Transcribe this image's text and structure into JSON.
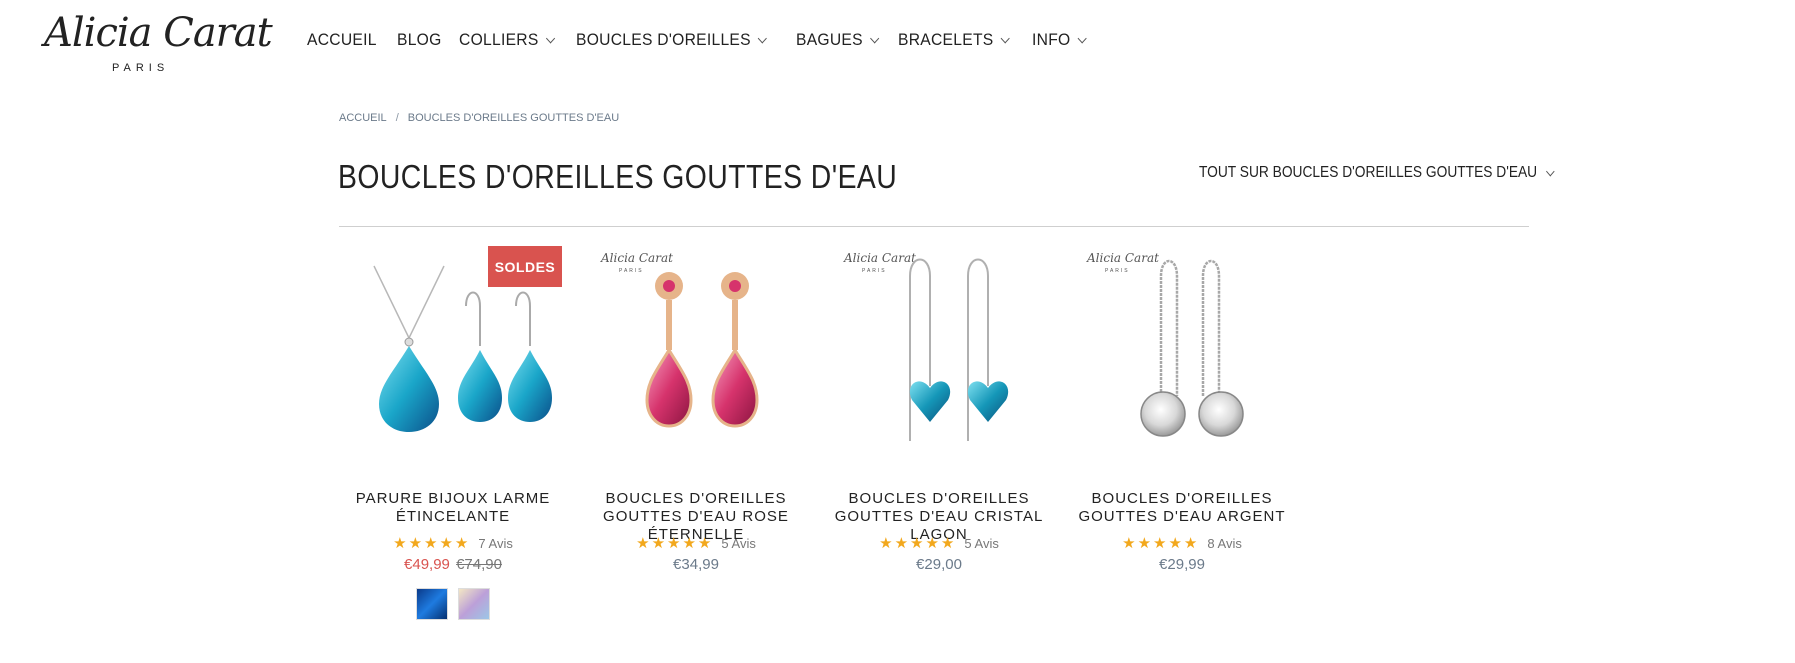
{
  "brand": {
    "name": "Alicia Carat",
    "sub": "PARIS"
  },
  "nav": {
    "items": [
      {
        "label": "ACCUEIL",
        "dropdown": false
      },
      {
        "label": "BLOG",
        "dropdown": false
      },
      {
        "label": "COLLIERS",
        "dropdown": true
      },
      {
        "label": "BOUCLES D'OREILLES",
        "dropdown": true
      },
      {
        "label": "BAGUES",
        "dropdown": true
      },
      {
        "label": "BRACELETS",
        "dropdown": true
      },
      {
        "label": "INFO",
        "dropdown": true
      }
    ]
  },
  "breadcrumb": {
    "home": "ACCUEIL",
    "separator": "/",
    "current": "BOUCLES D'OREILLES GOUTTES D'EAU"
  },
  "page": {
    "title": "BOUCLES D'OREILLES GOUTTES D'EAU"
  },
  "filter": {
    "label": "TOUT SUR BOUCLES D'OREILLES GOUTTES D'EAU"
  },
  "colors": {
    "accent": "#d9534f",
    "star": "#f2a81d",
    "price": "#6b7a8a"
  },
  "products": [
    {
      "name": "PARURE BIJOUX LARME ÉTINCELANTE",
      "stars": "★★★★★",
      "reviews": "7 Avis",
      "price": "€49,99",
      "old_price": "€74,90",
      "badge": "SOLDES",
      "image": "blue-teardrop-necklace-earrings-set",
      "swatches": [
        "blue-swatch",
        "aurora-swatch"
      ]
    },
    {
      "name": "BOUCLES D'OREILLES GOUTTES D'EAU ROSE ÉTERNELLE",
      "stars": "★★★★★",
      "reviews": "5 Avis",
      "price": "€34,99",
      "watermark": "Alicia Carat",
      "watermark_sub": "PARIS",
      "image": "pink-rose-drop-earrings"
    },
    {
      "name": "BOUCLES D'OREILLES GOUTTES D'EAU CRISTAL LAGON",
      "stars": "★★★★★",
      "reviews": "5 Avis",
      "price": "€29,00",
      "watermark": "Alicia Carat",
      "watermark_sub": "PARIS",
      "image": "blue-heart-threader-earrings"
    },
    {
      "name": "BOUCLES D'OREILLES GOUTTES D'EAU ARGENT",
      "stars": "★★★★★",
      "reviews": "8 Avis",
      "price": "€29,99",
      "watermark": "Alicia Carat",
      "watermark_sub": "PARIS",
      "image": "silver-crystal-threader-earrings"
    }
  ]
}
